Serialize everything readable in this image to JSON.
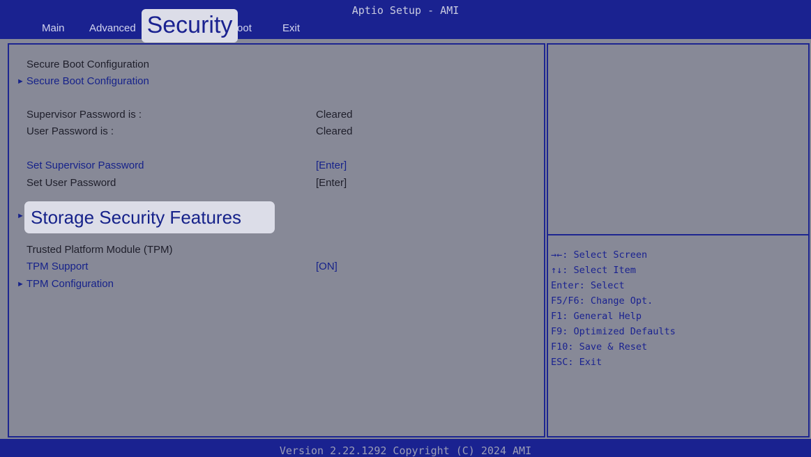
{
  "header": {
    "title": "Aptio Setup - AMI",
    "tabs": {
      "main": "Main",
      "advanced": "Advanced",
      "security": "Security",
      "boot": "Boot",
      "exit": "Exit"
    }
  },
  "menu": {
    "secure_boot_heading": "Secure Boot Configuration",
    "secure_boot_link": "Secure Boot Configuration",
    "supervisor_pw_label": "Supervisor Password is :",
    "supervisor_pw_value": "Cleared",
    "user_pw_label": "User Password is :",
    "user_pw_value": "Cleared",
    "set_supervisor_pw": "Set Supervisor Password",
    "set_supervisor_pw_value": "[Enter]",
    "set_user_pw": "Set User Password",
    "set_user_pw_value": "[Enter]",
    "storage_security": "Storage Security Features",
    "tpm_heading": "Trusted Platform Module (TPM)",
    "tpm_support": "TPM Support",
    "tpm_support_value": "[ON]",
    "tpm_config": "TPM Configuration"
  },
  "help": {
    "select_screen": "→←: Select Screen",
    "select_item": "↑↓: Select Item",
    "enter": "Enter: Select",
    "change_opt": "F5/F6: Change Opt.",
    "general_help": "F1: General Help",
    "optimized_defaults": "F9: Optimized Defaults",
    "save_reset": "F10: Save & Reset",
    "esc": "ESC: Exit"
  },
  "footer": {
    "version": "Version 2.22.1292 Copyright (C) 2024 AMI"
  },
  "colors": {
    "header_bg": "#1a2290",
    "panel_bg": "#878997",
    "highlight_bg": "#dcdde8",
    "link_text": "#16228a"
  }
}
